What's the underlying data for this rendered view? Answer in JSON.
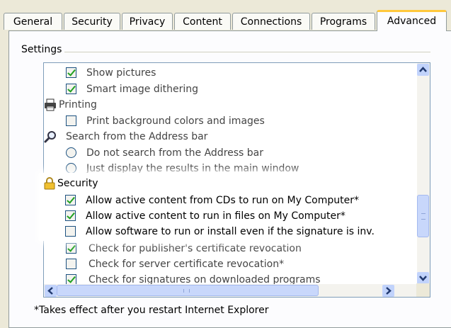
{
  "tabs": [
    {
      "label": "General"
    },
    {
      "label": "Security"
    },
    {
      "label": "Privacy"
    },
    {
      "label": "Content"
    },
    {
      "label": "Connections"
    },
    {
      "label": "Programs"
    },
    {
      "label": "Advanced",
      "active": true
    }
  ],
  "settings_group_label": "Settings",
  "settings": {
    "show_pictures": "Show pictures",
    "smart_dithering": "Smart image dithering",
    "printing_header": "Printing",
    "print_background": "Print background colors and images",
    "search_header": "Search from the Address bar",
    "do_not_search": "Do not search from the Address bar",
    "just_display": "Just display the results in the main window",
    "security_header": "Security",
    "allow_cds": "Allow active content from CDs to run on My Computer*",
    "allow_files": "Allow active content to run in files on My Computer*",
    "allow_software": "Allow software to run or install even if the signature is inv.",
    "check_publisher": "Check for publisher's certificate revocation",
    "check_server": "Check for server certificate revocation*",
    "check_signatures": "Check for signatures on downloaded programs"
  },
  "footnote": "*Takes effect after you restart Internet Explorer"
}
